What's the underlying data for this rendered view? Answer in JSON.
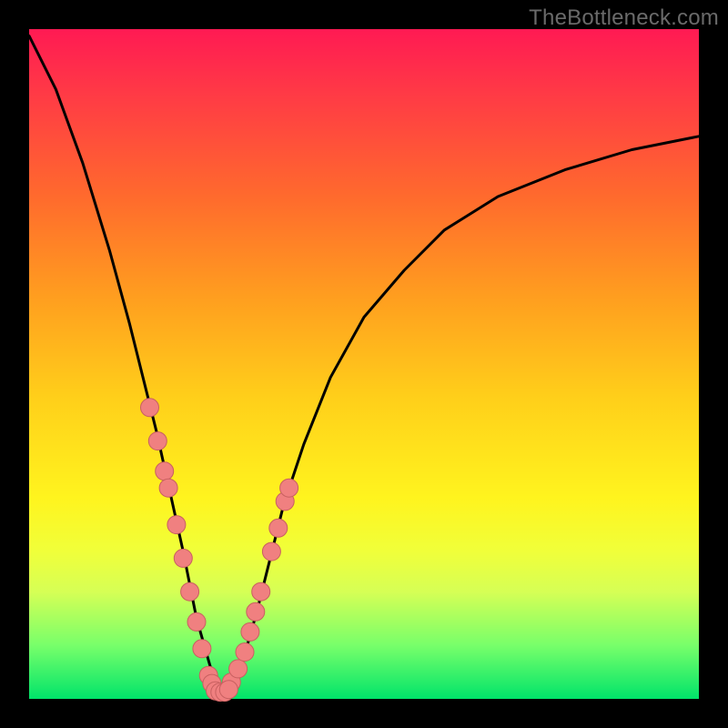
{
  "watermark": "TheBottleneck.com",
  "colors": {
    "background": "#000000",
    "curve_stroke": "#000000",
    "marker_fill": "#f08080",
    "marker_stroke": "#c86060"
  },
  "chart_data": {
    "type": "line",
    "title": "",
    "xlabel": "",
    "ylabel": "",
    "xlim": [
      0,
      100
    ],
    "ylim": [
      0,
      100
    ],
    "series": [
      {
        "name": "bottleneck-curve",
        "x": [
          0,
          4,
          8,
          12,
          15,
          17,
          19,
          21,
          23,
          25,
          27,
          28,
          29,
          30,
          32,
          34,
          36,
          38,
          41,
          45,
          50,
          56,
          62,
          70,
          80,
          90,
          100
        ],
        "values": [
          99,
          91,
          80,
          67,
          56,
          48,
          40,
          31,
          22,
          12,
          5,
          2,
          1,
          2,
          6,
          13,
          21,
          29,
          38,
          48,
          57,
          64,
          70,
          75,
          79,
          82,
          84
        ]
      }
    ],
    "markers_left": {
      "name": "left-branch-markers",
      "x": [
        18.0,
        19.2,
        20.2,
        20.8,
        22.0,
        23.0,
        24.0,
        25.0,
        25.8,
        26.8,
        27.3
      ],
      "values": [
        43.5,
        38.5,
        34.0,
        31.5,
        26.0,
        21.0,
        16.0,
        11.5,
        7.5,
        3.5,
        2.3
      ]
    },
    "markers_right": {
      "name": "right-branch-markers",
      "x": [
        30.2,
        31.2,
        32.2,
        33.0,
        33.8,
        34.6,
        36.2,
        37.2,
        38.2,
        38.8
      ],
      "values": [
        2.5,
        4.5,
        7.0,
        10.0,
        13.0,
        16.0,
        22.0,
        25.5,
        29.5,
        31.5
      ]
    },
    "markers_bottom": {
      "name": "valley-markers",
      "x": [
        27.8,
        28.5,
        29.2,
        29.8
      ],
      "values": [
        1.2,
        1.0,
        1.0,
        1.4
      ]
    }
  }
}
